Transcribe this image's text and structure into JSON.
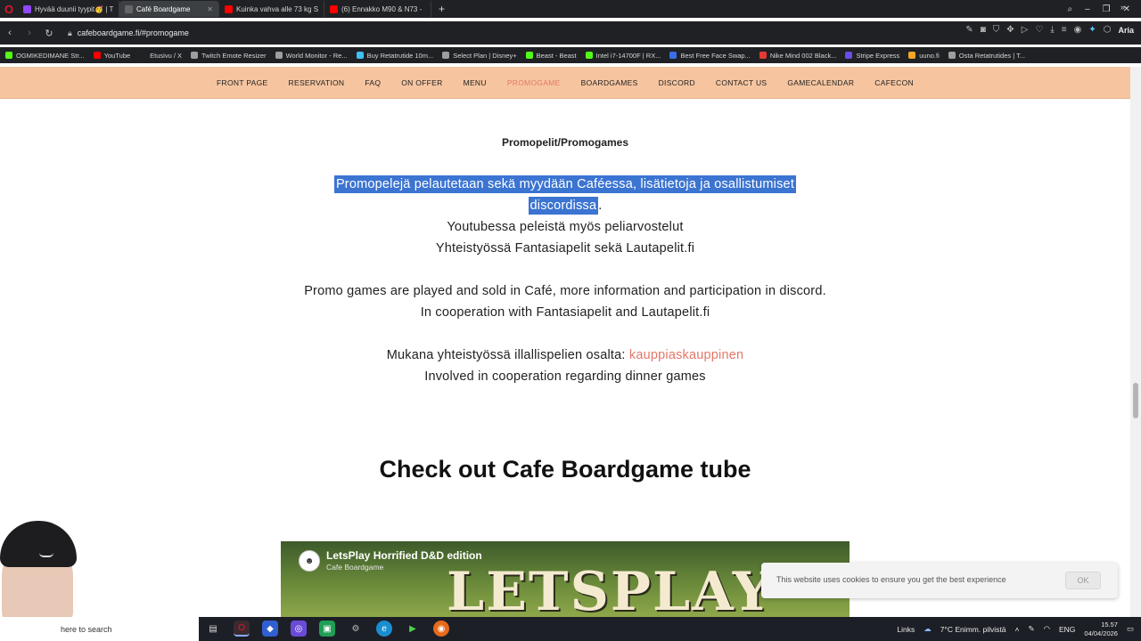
{
  "browser": {
    "tabs": [
      {
        "label": "Hyvää duunii tyypit🥳 | T",
        "active": false,
        "color": "#9146ff"
      },
      {
        "label": "Café Boardgame",
        "active": true,
        "color": "#666666"
      },
      {
        "label": "Kuinka vahva alle 73 kg S",
        "active": false,
        "color": "#ff0000"
      },
      {
        "label": "(6) Ennakko M90 & N73 -",
        "active": false,
        "color": "#ff0000"
      }
    ],
    "new_tab": "+",
    "url": "cafeboardgame.fi/#promogame",
    "aria_label": "Aria"
  },
  "bookmarks": [
    {
      "label": "OGMIKEDIMANE Str...",
      "color": "#53fc18"
    },
    {
      "label": "YouTube",
      "color": "#ff0000"
    },
    {
      "label": "Etusivu / X",
      "color": "#222222"
    },
    {
      "label": "Twitch Emote Resizer",
      "color": "#9e9e9e"
    },
    {
      "label": "World Monitor - Re...",
      "color": "#9e9e9e"
    },
    {
      "label": "Buy Retatrutide 10m...",
      "color": "#3ec0f0"
    },
    {
      "label": "Select Plan | Disney+",
      "color": "#9e9e9e"
    },
    {
      "label": "Beast - Beast",
      "color": "#53fc18"
    },
    {
      "label": "Intel i7-14700F | RX...",
      "color": "#53fc18"
    },
    {
      "label": "Best Free Face Swap...",
      "color": "#3a6ee8"
    },
    {
      "label": "Nike Mind 002 Black...",
      "color": "#e53935"
    },
    {
      "label": "Stripe Express",
      "color": "#6b4ce6"
    },
    {
      "label": "uuno.fi",
      "color": "#f5a623"
    },
    {
      "label": "Osta Retatrutides | T...",
      "color": "#9e9e9e"
    }
  ],
  "site_nav": {
    "items": [
      "FRONT PAGE",
      "RESERVATION",
      "FAQ",
      "ON OFFER",
      "MENU",
      "PROMOGAME",
      "BOARDGAMES",
      "DISCORD",
      "CONTACT US",
      "GAMECALENDAR",
      "CAFECON"
    ],
    "current": "PROMOGAME"
  },
  "content": {
    "promo_title": "Promopelit/Promogames",
    "fi_line1_selected": "Promopelejä pelautetaan sekä myydään Caféessa, lisätietoja ja osallistumiset",
    "fi_line2_selected": "discordissa",
    "fi_line2_rest": ".",
    "fi_line3": "Youtubessa peleistä myös peliarvostelut",
    "fi_line4": "Yhteistyössä Fantasiapelit sekä Lautapelit.fi",
    "en_line1": "Promo games are played and sold in Café, more information and participation in discord.",
    "en_line2": "In cooperation with Fantasiapelit and Lautapelit.fi",
    "coop_prefix": "Mukana yhteistyössä illallispelien osalta:",
    "coop_link": "kauppiaskauppinen",
    "coop_en": "Involved in cooperation regarding dinner games",
    "tube_title": "Check out Cafe Boardgame tube"
  },
  "video": {
    "title": "LetsPlay Horrified D&D edition",
    "channel": "Cafe Boardgame",
    "overlay_text": "LETSPLAY"
  },
  "cookie": {
    "text": "This website uses cookies to ensure you get the best experience",
    "ok_label": "OK"
  },
  "taskbar": {
    "search_placeholder": "here to search",
    "tray_links": "Links",
    "weather": "7°C  Enimm. pilvistä",
    "language": "ENG",
    "time": "15.57",
    "date": "04/04/2026"
  },
  "colors": {
    "nav_bg": "#f6c5a0",
    "accent": "#e5776a",
    "selection": "#3b74d1"
  }
}
